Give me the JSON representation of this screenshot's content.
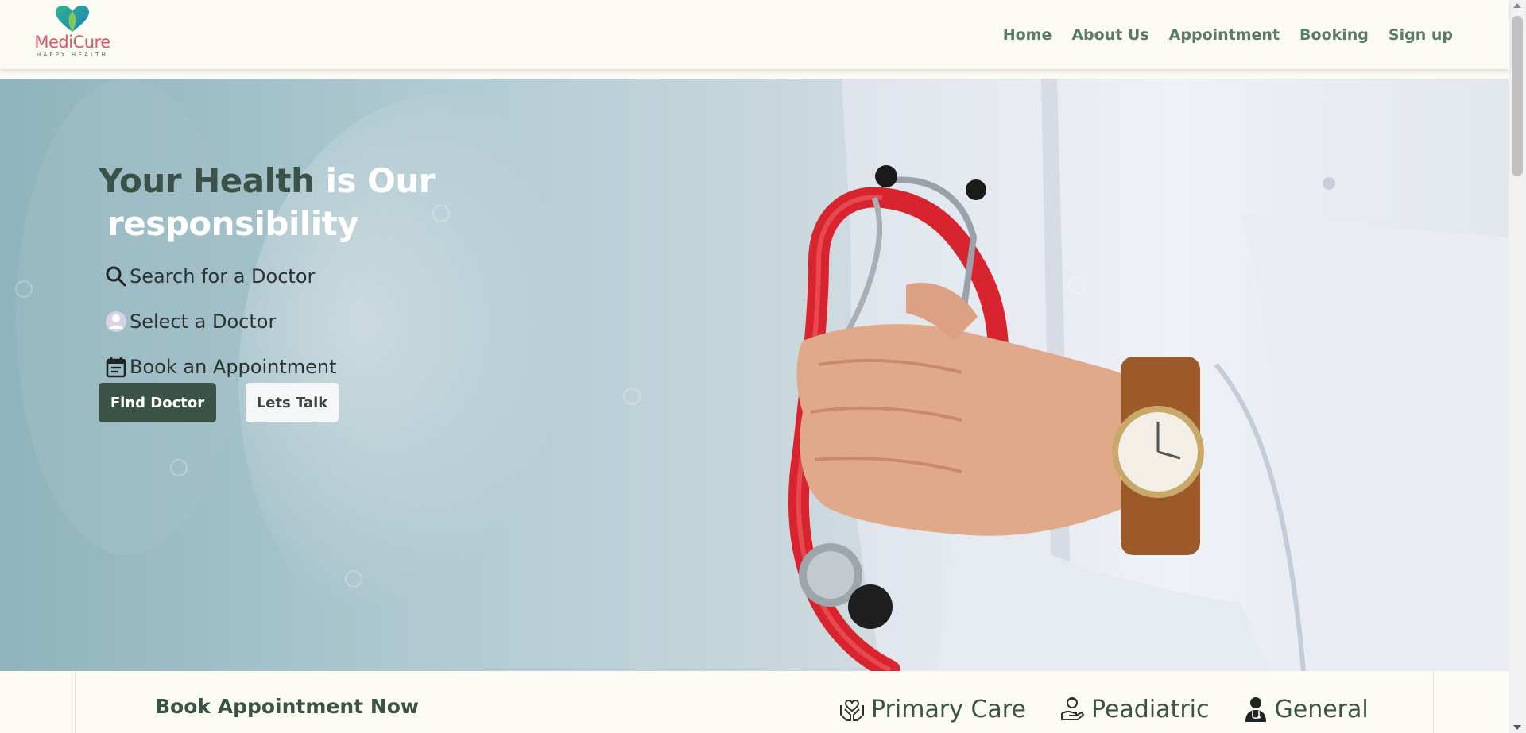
{
  "brand": {
    "name": "MediCure",
    "tagline": "HAPPY HEALTH"
  },
  "nav": {
    "items": [
      "Home",
      "About Us",
      "Appointment",
      "Booking",
      "Sign up"
    ]
  },
  "hero": {
    "headline_part1": "Your Health",
    "headline_part2": " is Our",
    "headline_line2": "responsibility",
    "steps": [
      {
        "icon": "search-icon",
        "label": "Search for a Doctor"
      },
      {
        "icon": "user-avatar-icon",
        "label": "Select a Doctor"
      },
      {
        "icon": "calendar-icon",
        "label": "Book an Appointment"
      }
    ],
    "primary_button": "Find Doctor",
    "secondary_button": "Lets Talk",
    "image": "doctor-with-stethoscope-photo"
  },
  "booking": {
    "title": "Book Appointment Now",
    "categories": [
      {
        "icon": "hands-heart-icon",
        "label": "Primary Care"
      },
      {
        "icon": "child-care-icon",
        "label": "Peadiatric"
      },
      {
        "icon": "doctor-icon",
        "label": "General"
      }
    ]
  },
  "colors": {
    "brand_red": "#e05565",
    "primary_green": "#3b5246",
    "nav_text": "#5a7a6a",
    "background": "#fbfbf3"
  }
}
